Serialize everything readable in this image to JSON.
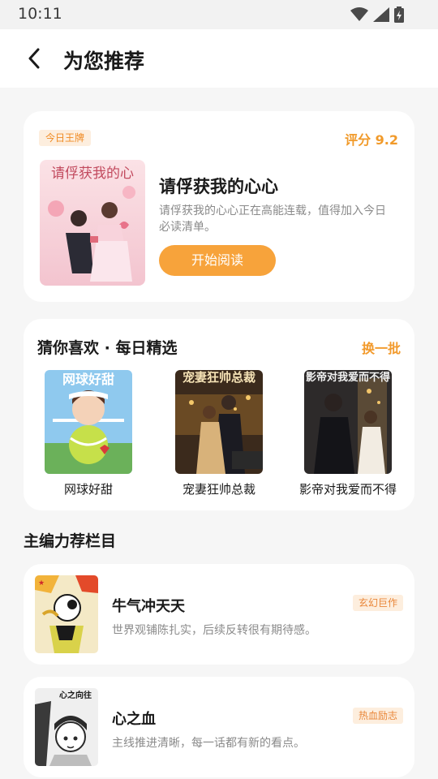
{
  "status_bar": {
    "time": "10:11"
  },
  "header": {
    "title": "为您推荐"
  },
  "featured": {
    "badge": "今日王牌",
    "rating": "评分 9.2",
    "cover_caption": "请俘获我的心",
    "title": "请俘获我的心心",
    "description": "请俘获我的心心正在高能连载，值得加入今日必读清单。",
    "button_label": "开始阅读"
  },
  "guess": {
    "title": "猜你喜欢 · 每日精选",
    "refresh_label": "换一批",
    "books": [
      {
        "name": "网球好甜",
        "cover_caption": "网球好甜"
      },
      {
        "name": "宠妻狂帅总裁",
        "cover_caption": "宠妻狂帅总裁"
      },
      {
        "name": "影帝对我爱而不得",
        "cover_caption": "影帝对我爱而不得"
      }
    ]
  },
  "editor_section": {
    "title": "主编力荐栏目",
    "items": [
      {
        "title": "牛气冲天天",
        "description": "世界观铺陈扎实，后续反转很有期待感。",
        "tag": "玄幻巨作"
      },
      {
        "title": "心之血",
        "description": "主线推进清晰，每一话都有新的看点。",
        "tag": "热血励志",
        "cover_caption": "心之向往"
      }
    ]
  },
  "colors": {
    "accent": "#f7a33b",
    "tag_bg": "#fdeede",
    "background": "#f6f6f6"
  }
}
